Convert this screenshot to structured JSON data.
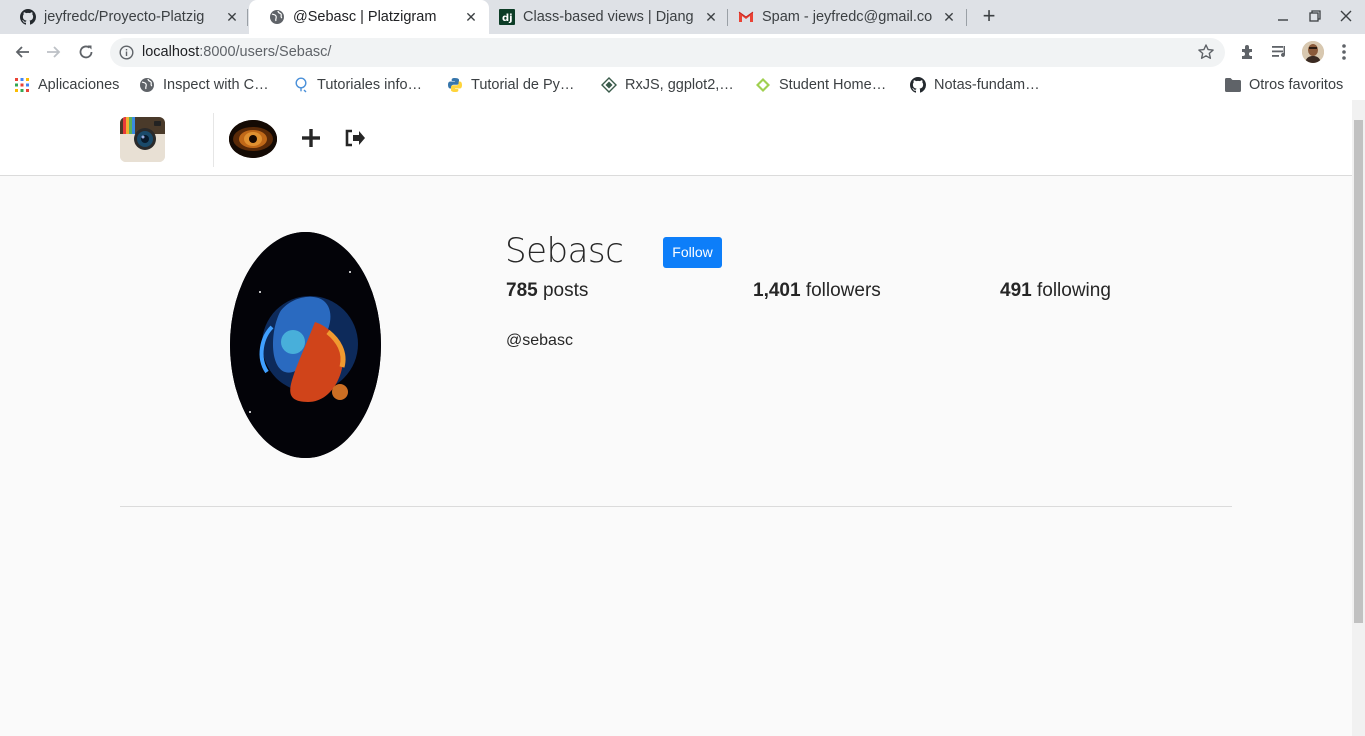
{
  "browser": {
    "tabs": [
      {
        "title": "jeyfredc/Proyecto-Platzig",
        "icon": "github-icon",
        "active": false
      },
      {
        "title": "@Sebasc | Platzigram",
        "icon": "globe-icon",
        "active": true
      },
      {
        "title": "Class-based views | Djang",
        "icon": "django-icon",
        "active": false
      },
      {
        "title": "Spam - jeyfredc@gmail.co",
        "icon": "gmail-icon",
        "active": false
      }
    ],
    "new_tab_label": "+",
    "url_host": "localhost",
    "url_rest": ":8000/users/Sebasc/",
    "bookmarks": [
      {
        "label": "Aplicaciones",
        "icon": "apps-grid-icon"
      },
      {
        "label": "Inspect with C…",
        "icon": "globe-icon"
      },
      {
        "label": "Tutoriales info…",
        "icon": "bulb-icon"
      },
      {
        "label": "Tutorial de Py…",
        "icon": "python-icon"
      },
      {
        "label": "RxJS, ggplot2,…",
        "icon": "diamond-icon"
      },
      {
        "label": "Student Home…",
        "icon": "student-icon"
      },
      {
        "label": "Notas-fundam…",
        "icon": "github-icon"
      }
    ],
    "other_bookmarks": "Otros favoritos"
  },
  "site": {
    "username": "Sebasc",
    "follow_label": "Follow",
    "stats": {
      "posts_count": "785",
      "posts_label": "posts",
      "followers_count": "1,401",
      "followers_label": "followers",
      "following_count": "491",
      "following_label": "following"
    },
    "handle": "@sebasc"
  },
  "colors": {
    "accent": "#0d7ef9",
    "page_bg": "#fafafa",
    "text": "#262626"
  }
}
